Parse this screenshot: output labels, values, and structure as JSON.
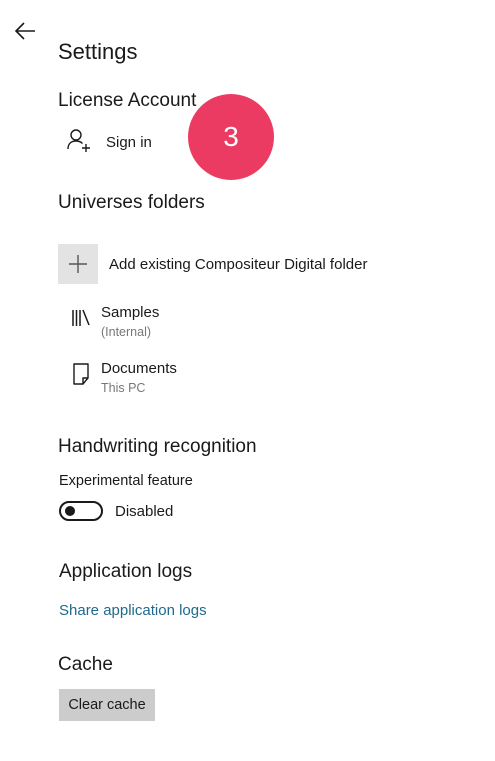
{
  "header": {
    "back_icon": "arrow-left-icon",
    "title": "Settings"
  },
  "license": {
    "title": "License Account",
    "sign_in_label": "Sign in",
    "sign_in_icon": "person-add-icon"
  },
  "step_badge": {
    "number": "3",
    "color": "#ec3b63"
  },
  "universes": {
    "title": "Universes folders",
    "add_label": "Add existing Compositeur Digital folder",
    "add_icon": "plus-icon",
    "folders": [
      {
        "name": "Samples",
        "location": "(Internal)",
        "icon": "library-books-icon"
      },
      {
        "name": "Documents",
        "location": "This PC",
        "icon": "document-icon"
      }
    ]
  },
  "handwriting": {
    "title": "Handwriting recognition",
    "feature_label": "Experimental feature",
    "toggle_state": "Disabled",
    "toggle_on": false
  },
  "logs": {
    "title": "Application logs",
    "share_link": "Share application logs",
    "link_color": "#1f6a8c"
  },
  "cache": {
    "title": "Cache",
    "clear_button": "Clear cache"
  }
}
